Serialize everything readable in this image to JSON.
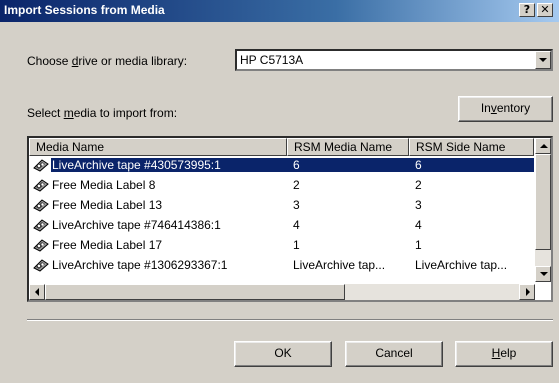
{
  "window": {
    "title": "Import Sessions from Media",
    "help_button": "?",
    "close_button": "✕"
  },
  "drive": {
    "label_pre": "Choose ",
    "label_accel": "d",
    "label_post": "rive or media library:",
    "selected": "HP C5713A"
  },
  "media": {
    "label_pre": "Select ",
    "label_accel": "m",
    "label_post": "edia to import from:"
  },
  "inventory_button": {
    "pre": "In",
    "accel": "v",
    "post": "entory"
  },
  "columns": [
    "Media Name",
    "RSM Media Name",
    "RSM Side Name"
  ],
  "rows": [
    {
      "name": "LiveArchive tape #430573995:1",
      "rsm_media": "6",
      "rsm_side": "6",
      "selected": true
    },
    {
      "name": "Free Media Label 8",
      "rsm_media": "2",
      "rsm_side": "2",
      "selected": false
    },
    {
      "name": "Free Media Label 13",
      "rsm_media": "3",
      "rsm_side": "3",
      "selected": false
    },
    {
      "name": "LiveArchive tape #746414386:1",
      "rsm_media": "4",
      "rsm_side": "4",
      "selected": false
    },
    {
      "name": "Free Media Label 17",
      "rsm_media": "1",
      "rsm_side": "1",
      "selected": false
    },
    {
      "name": "LiveArchive tape #1306293367:1",
      "rsm_media": "LiveArchive tap...",
      "rsm_side": "LiveArchive tap...",
      "selected": false
    }
  ],
  "buttons": {
    "ok": "OK",
    "cancel": "Cancel",
    "help_accel": "H",
    "help_post": "elp"
  },
  "colors": {
    "title_bar": "#0a246a",
    "selection": "#0a246a",
    "dialog_bg": "#d4d0c8"
  },
  "icons": {
    "row_icon": "tape-cartridge-icon"
  }
}
